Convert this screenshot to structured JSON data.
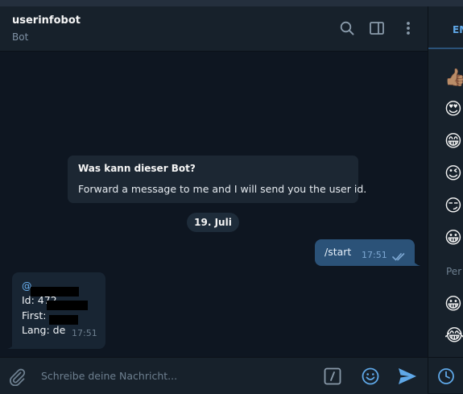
{
  "header": {
    "title": "userinfobot",
    "subtitle": "Bot"
  },
  "info_card": {
    "question": "Was kann dieser Bot?",
    "answer": "Forward a message to me and I will send you the user id."
  },
  "date_separator": "19. Juli",
  "messages": {
    "outgoing": {
      "text": "/start",
      "time": "17:51",
      "status": "read"
    },
    "incoming": {
      "lines": [
        "@",
        "Id: 472",
        "First: ",
        "Lang: de"
      ],
      "time": "17:51"
    }
  },
  "composer": {
    "placeholder": "Schreibe deine Nachricht..."
  },
  "emoji_panel": {
    "tab": "EM",
    "category": "Per",
    "emojis": [
      "👍🏽",
      "😍",
      "😁",
      "😉",
      "😏",
      "😀",
      "😀",
      "😂"
    ]
  },
  "colors": {
    "background": "#0e1621",
    "panel": "#17212b",
    "outgoing_bubble": "#2b5278",
    "incoming_bubble": "#182533",
    "accent": "#5fa8e8"
  },
  "icons": {
    "header": [
      "search-icon",
      "sidebar-toggle-icon",
      "more-vertical-icon"
    ],
    "composer": [
      "attach-icon",
      "bot-command-icon",
      "emoji-smile-icon",
      "send-icon"
    ],
    "emoji_panel": [
      "recent-clock-icon"
    ]
  }
}
